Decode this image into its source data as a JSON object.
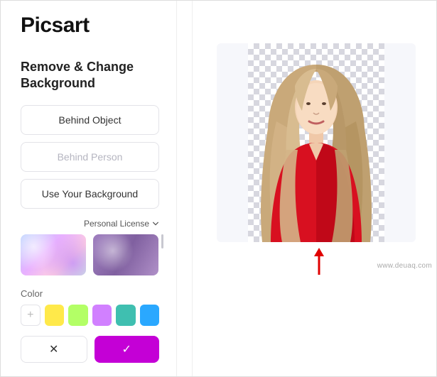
{
  "brand": {
    "name": "Picsart"
  },
  "sidebar": {
    "title": "Remove & Change Background",
    "buttons": {
      "behind_object": "Behind Object",
      "behind_person": "Behind Person",
      "use_your_bg": "Use Your Background"
    },
    "license_label": "Personal License",
    "color_label": "Color",
    "swatches": {
      "add": "+",
      "c1": "#ffe94a",
      "c2": "#b3ff66",
      "c3": "#d180ff",
      "c4": "#3fbfb0",
      "c5": "#2aa8ff"
    },
    "actions": {
      "cancel": "✕",
      "confirm": "✓"
    }
  },
  "canvas": {
    "subject_desc": "woman-with-long-wavy-blonde-hair-red-top"
  },
  "watermark": "www.deuaq.com"
}
